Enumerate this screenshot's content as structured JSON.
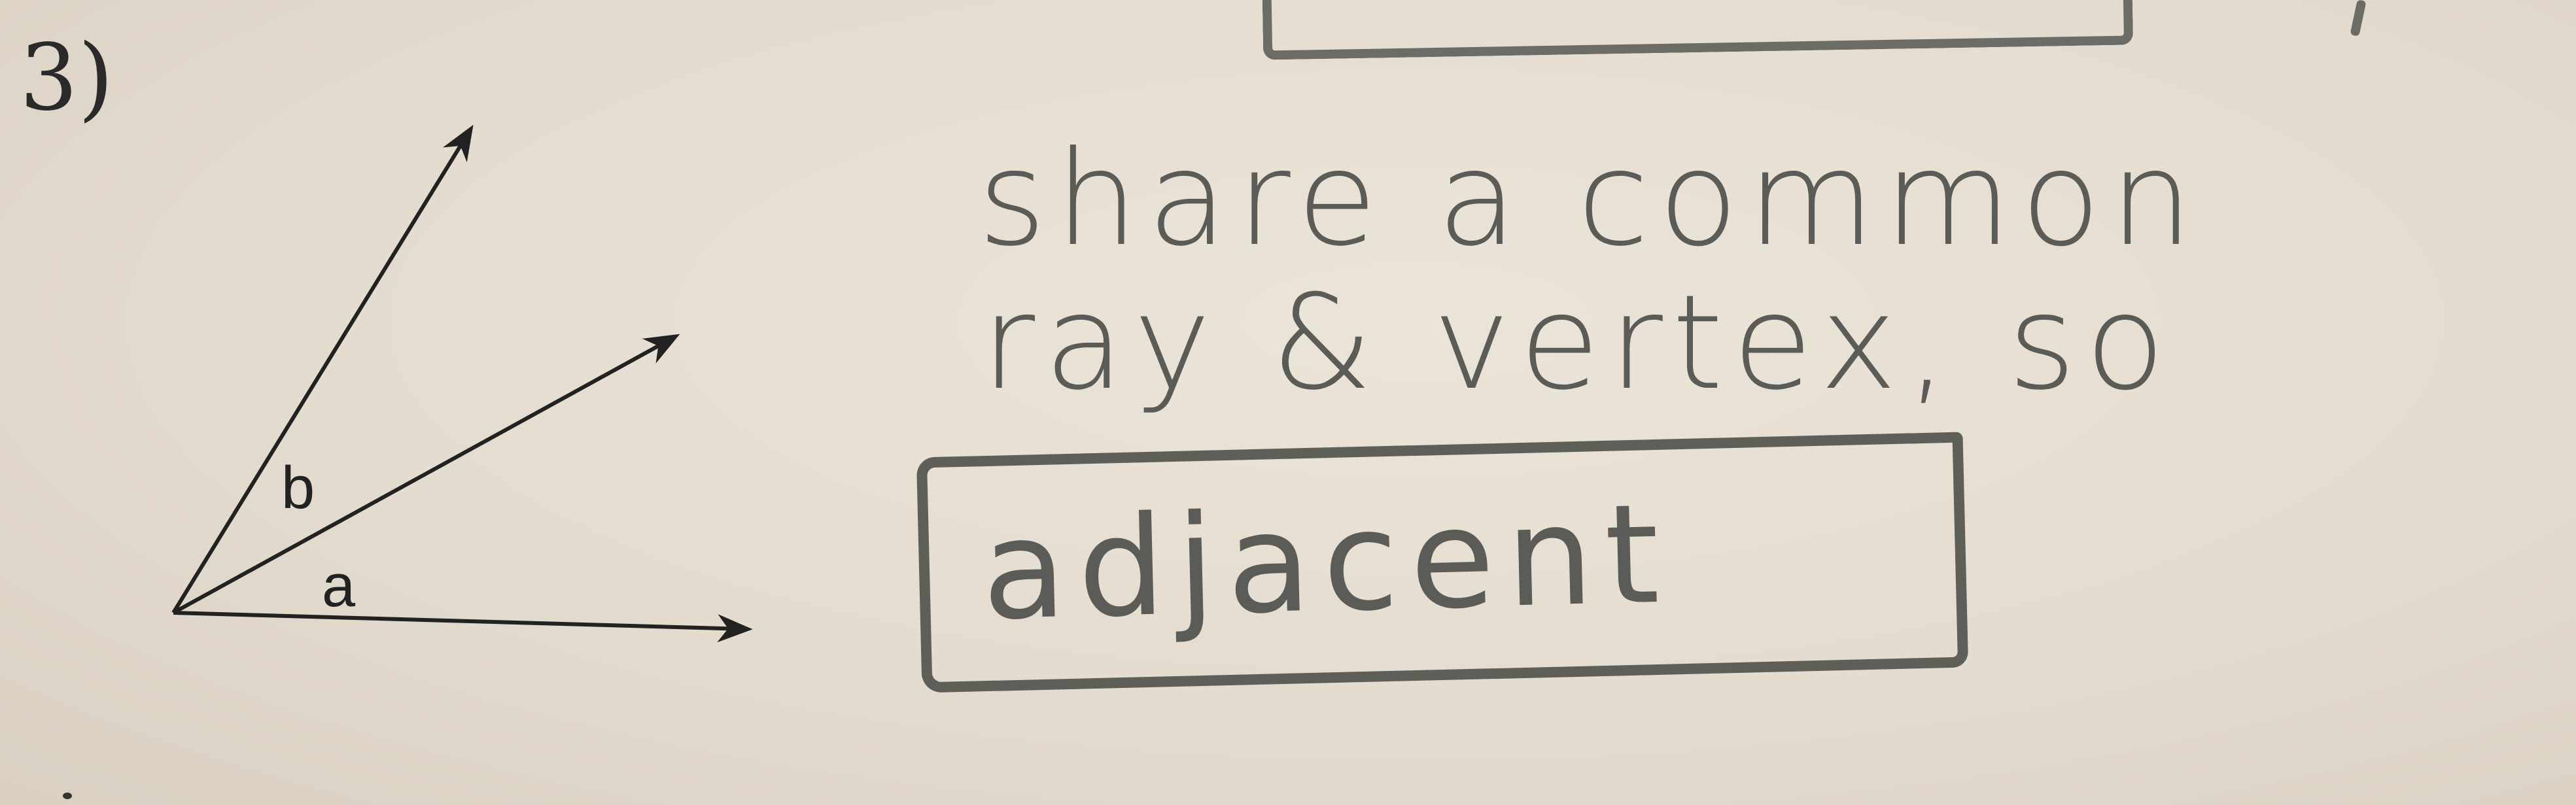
{
  "problem": {
    "number": "3)"
  },
  "diagram": {
    "label_b": "b",
    "label_a": "a",
    "line_color": "#222222"
  },
  "handwriting": {
    "line_1": "share a common",
    "line_2": "ray & vertex, so",
    "answer": "adjacent",
    "ink_color": "#5b5b57"
  }
}
